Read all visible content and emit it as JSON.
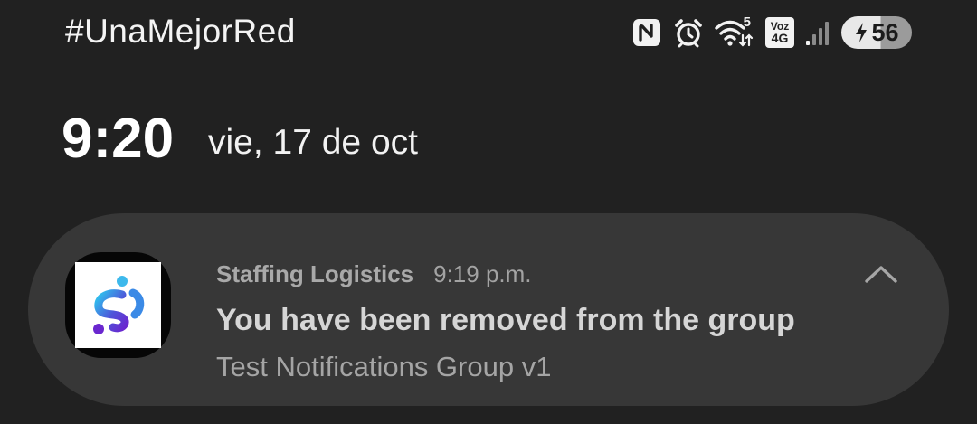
{
  "status_bar": {
    "carrier_text": "#UnaMejorRed",
    "wifi_badge": "5",
    "volte_top": "Voz",
    "volte_bottom": "4G",
    "battery_level": "56",
    "icons": [
      "nfc-icon",
      "alarm-icon",
      "wifi-icon",
      "volte-icon",
      "signal-icon",
      "battery-charging-icon"
    ]
  },
  "lockscreen": {
    "time": "9:20",
    "date": "vie, 17 de oct"
  },
  "notification": {
    "app_name": "Staffing Logistics",
    "time": "9:19 p.m.",
    "title": "You have been removed from the group",
    "body": "Test Notifications Group v1",
    "icon": "staffing-logistics-logo",
    "action_icon": "chevron-up-icon"
  },
  "colors": {
    "background": "#212121",
    "card": "#373737",
    "logo_purple": "#5b2bd3",
    "logo_cyan": "#29c6ef"
  }
}
